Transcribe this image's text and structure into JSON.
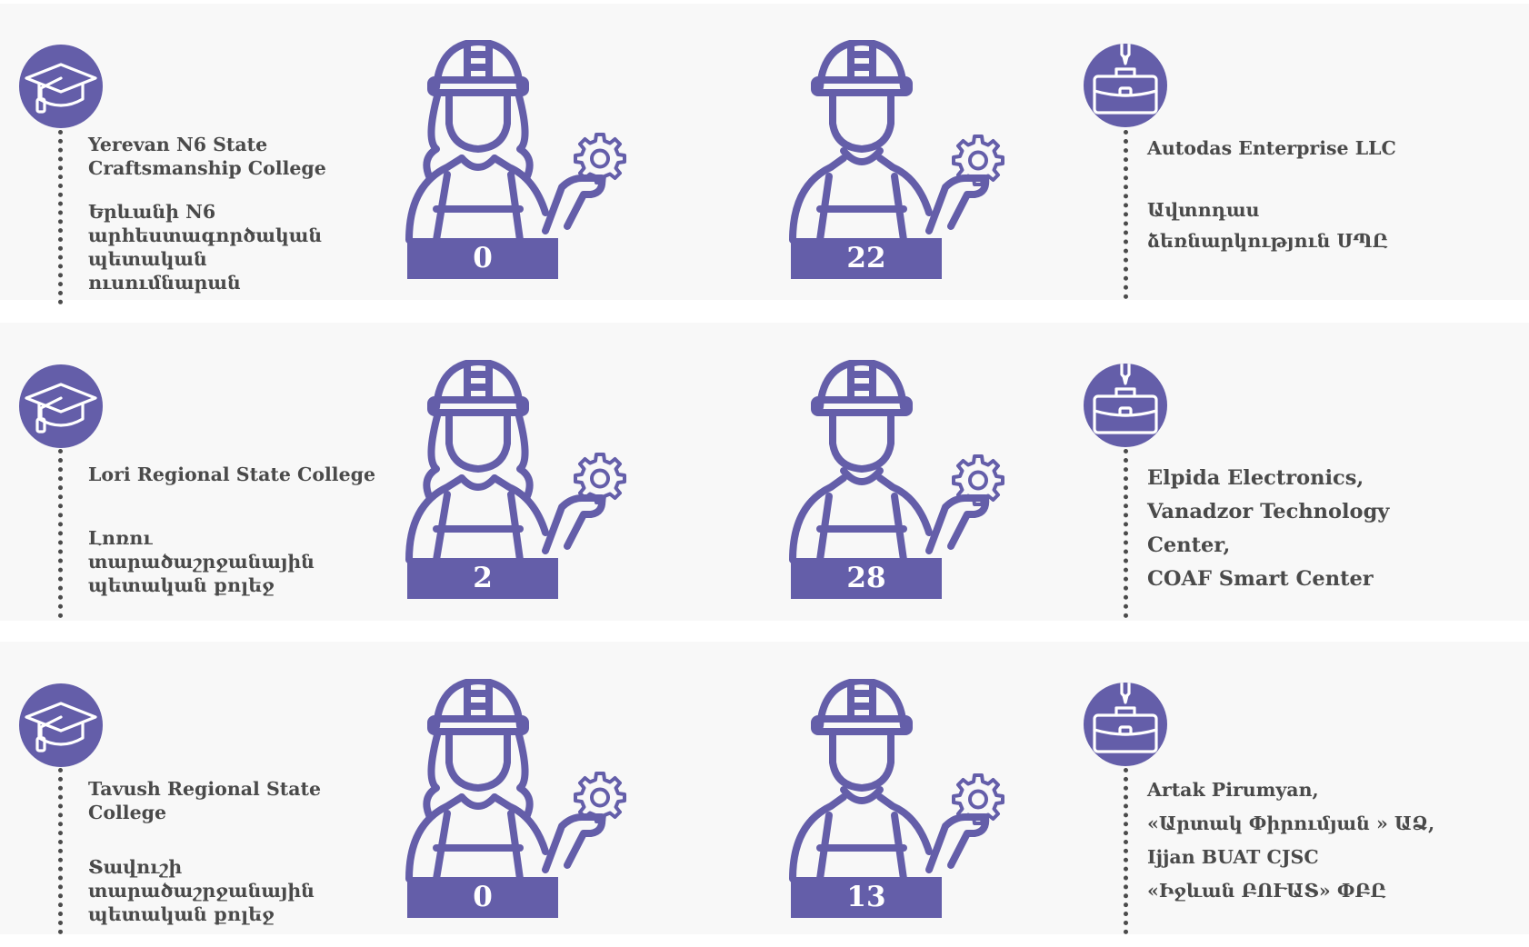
{
  "colors": {
    "accent": "#645ea9",
    "band": "#f8f8f8",
    "text": "#4a4a4a"
  },
  "icons": {
    "college": "graduation-cap-icon",
    "female": "female-worker-icon",
    "male": "male-worker-icon",
    "gear": "gear-icon",
    "company": "briefcase-icon"
  },
  "rows": [
    {
      "college_en": [
        "Yerevan N6 State",
        "Craftsmanship College"
      ],
      "college_hy": [
        "Երևանի N6",
        "արհեստագործական",
        "պետական",
        "ուսումնարան"
      ],
      "female_count": "0",
      "male_count": "22",
      "companies": [
        "Autodas Enterprise LLC",
        "",
        "Ավտոդաս",
        "ձեռնարկություն ՍՊԸ"
      ]
    },
    {
      "college_en": [
        "Lori Regional State College"
      ],
      "college_hy": [
        "Լոռու",
        "տարածաշրջանային",
        "պետական քոլեջ"
      ],
      "female_count": "2",
      "male_count": "28",
      "companies": [
        "Elpida Electronics,",
        "Vanadzor Technology",
        "Center,",
        "COAF Smart Center"
      ]
    },
    {
      "college_en": [
        "Tavush Regional State",
        "College"
      ],
      "college_hy": [
        "Տավուշի",
        "տարածաշրջանային",
        "պետական քոլեջ"
      ],
      "female_count": "0",
      "male_count": "13",
      "companies": [
        "Artak Pirumyan,",
        " «Արտակ Փիրումյան »  ԱՁ,",
        "Ijjan BUAT CJSC",
        "«Իջևան ԲՈՒԱՏ» ՓԲԸ"
      ]
    }
  ]
}
